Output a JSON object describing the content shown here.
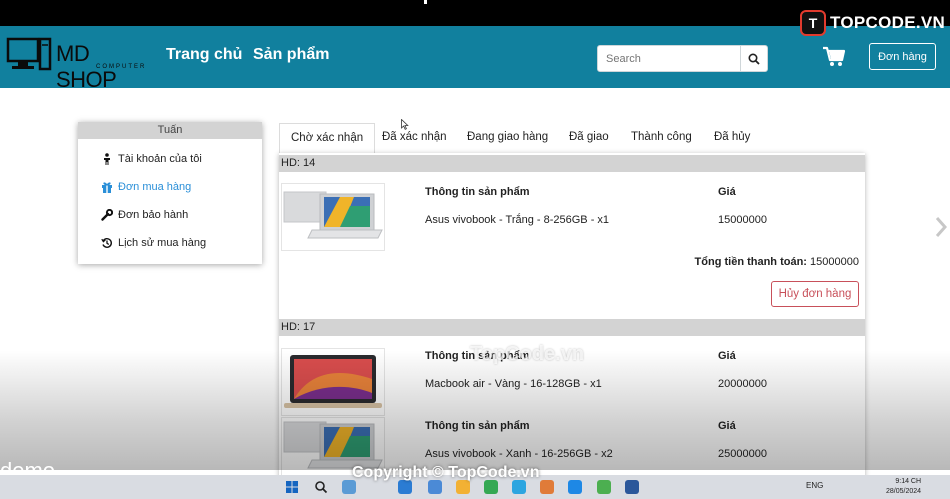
{
  "watermark": {
    "brand": "TOPCODE.VN",
    "badge": "T",
    "center_text": "TopCode.vn",
    "copyright": "Copyright © TopCode.vn"
  },
  "navbar": {
    "brand": "MD SHOP",
    "brand_sub": "COMPUTER",
    "links": [
      "Trang chủ",
      "Sản phẩm"
    ],
    "search_placeholder": "Search",
    "orders_button": "Đơn hàng"
  },
  "side_menu": {
    "user": "Tuấn",
    "items": [
      {
        "label": "Tài khoản của tôi",
        "icon": "person-icon"
      },
      {
        "label": "Đơn mua hàng",
        "icon": "gift-icon",
        "active": true
      },
      {
        "label": "Đơn bảo hành",
        "icon": "wrench-icon"
      },
      {
        "label": "Lịch sử mua hàng",
        "icon": "history-icon"
      }
    ]
  },
  "tabs": [
    "Chờ xác nhận",
    "Đã xác nhận",
    "Đang giao hàng",
    "Đã giao",
    "Thành công",
    "Đã hủy"
  ],
  "orders": [
    {
      "header": "HD: 14",
      "items": [
        {
          "info_label": "Thông tin sản phẩm",
          "name": "Asus vivobook - Trắng - 8-256GB - x1",
          "price_label": "Giá",
          "price": "15000000"
        }
      ],
      "total_label": "Tổng tiền thanh toán:",
      "total": "15000000",
      "cancel": "Hủy đơn hàng"
    },
    {
      "header": "HD: 17",
      "items": [
        {
          "info_label": "Thông tin sản phẩm",
          "name": "Macbook air - Vàng - 16-128GB - x1",
          "price_label": "Giá",
          "price": "20000000"
        },
        {
          "info_label": "Thông tin sản phẩm",
          "name": "Asus vivobook - Xanh - 16-256GB - x2",
          "price_label": "Giá",
          "price": "25000000"
        }
      ]
    }
  ],
  "overlay": {
    "demo": "demo"
  },
  "taskbar": {
    "lang": "ENG",
    "time": "9:14 CH",
    "date": "28/05/2024"
  },
  "colors": {
    "navbar": "#11809e",
    "cancel": "#c8505a",
    "active_link": "#2a8fd8",
    "header_bg": "#d3d3d3"
  }
}
